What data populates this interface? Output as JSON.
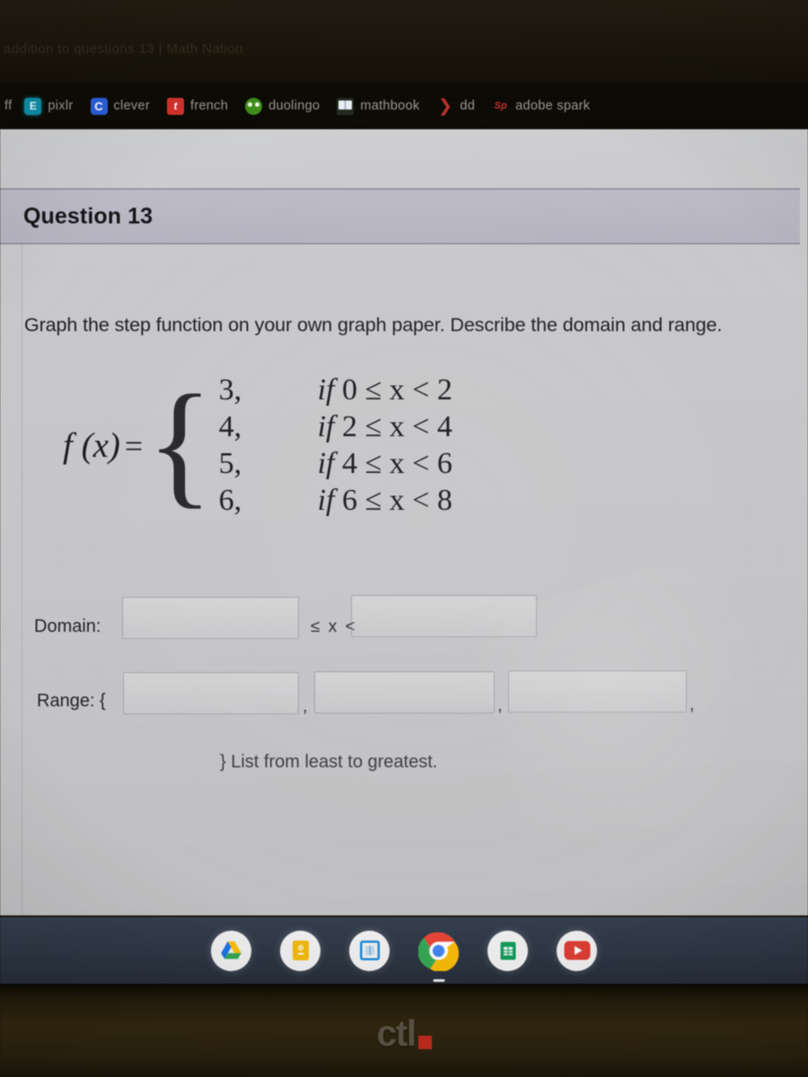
{
  "browser": {
    "tab_strip_text": "addition to questions 13 | Math Nation",
    "bookmarks": [
      {
        "label": "ff",
        "icon": "favicon-icon",
        "icon_class": "ico-ff",
        "glyph": ""
      },
      {
        "label": "pixlr",
        "icon": "pixlr-icon",
        "icon_class": "ico-pixlr",
        "glyph": "E"
      },
      {
        "label": "clever",
        "icon": "clever-icon",
        "icon_class": "ico-clever",
        "glyph": "C"
      },
      {
        "label": "french",
        "icon": "tinycards-icon",
        "icon_class": "ico-french",
        "glyph": "t"
      },
      {
        "label": "duolingo",
        "icon": "duolingo-owl-icon",
        "icon_class": "ico-duo",
        "glyph": ""
      },
      {
        "label": "mathbook",
        "icon": "open-book-icon",
        "icon_class": "ico-math",
        "glyph": ""
      },
      {
        "label": "dd",
        "icon": "crescent-icon",
        "icon_class": "ico-dd",
        "glyph": "❯"
      },
      {
        "label": "adobe spark",
        "icon": "adobe-spark-icon",
        "icon_class": "ico-spark",
        "glyph": "Sp"
      }
    ]
  },
  "question": {
    "title": "Question 13",
    "prompt": "Graph the step function on your own graph paper.  Describe the domain and range.",
    "function": {
      "name": "f (x)",
      "equals": "=",
      "cases": [
        {
          "value": "3,",
          "condition_if": "if",
          "condition": "0 ≤ x < 2"
        },
        {
          "value": "4,",
          "condition_if": "if",
          "condition": "2 ≤ x < 4"
        },
        {
          "value": "5,",
          "condition_if": "if",
          "condition": "4 ≤ x < 6"
        },
        {
          "value": "6,",
          "condition_if": "if",
          "condition": "6 ≤ x < 8"
        }
      ]
    },
    "domain": {
      "label": "Domain:",
      "input_lower_value": "",
      "operator": "≤ x <",
      "input_upper_value": ""
    },
    "range": {
      "label": "Range: {",
      "inputs": [
        "",
        "",
        ""
      ],
      "separator": ",",
      "note": "}  List from least to greatest."
    }
  },
  "shelf": {
    "apps": [
      {
        "name": "google-drive",
        "running": false
      },
      {
        "name": "google-keep",
        "running": false
      },
      {
        "name": "google-docs",
        "running": false
      },
      {
        "name": "chrome",
        "running": true
      },
      {
        "name": "google-sheets",
        "running": false
      },
      {
        "name": "youtube",
        "running": false
      }
    ]
  },
  "device": {
    "brand": "ctl",
    "accent_color": "#bf2d1f"
  },
  "colors": {
    "page_background": "#c6c5c7",
    "banner_background": "#b8b7c4",
    "shelf_background": "#2b3442",
    "text_primary": "#1a1a1e"
  }
}
